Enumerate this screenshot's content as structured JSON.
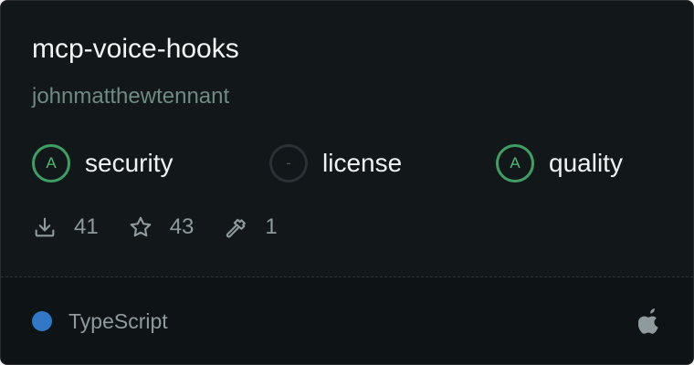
{
  "card": {
    "title": "mcp-voice-hooks",
    "owner": "johnmatthewtennant",
    "scores": [
      {
        "grade": "A",
        "label": "security",
        "status": "pass"
      },
      {
        "grade": "-",
        "label": "license",
        "status": "none"
      },
      {
        "grade": "A",
        "label": "quality",
        "status": "pass"
      }
    ],
    "stats": {
      "downloads": "41",
      "stars": "43",
      "tools": "1"
    },
    "language": {
      "name": "TypeScript",
      "color": "#3178c6"
    },
    "platform_icon": "apple-icon"
  },
  "colors": {
    "accent_green": "#3f9e63",
    "background": "#121819"
  }
}
